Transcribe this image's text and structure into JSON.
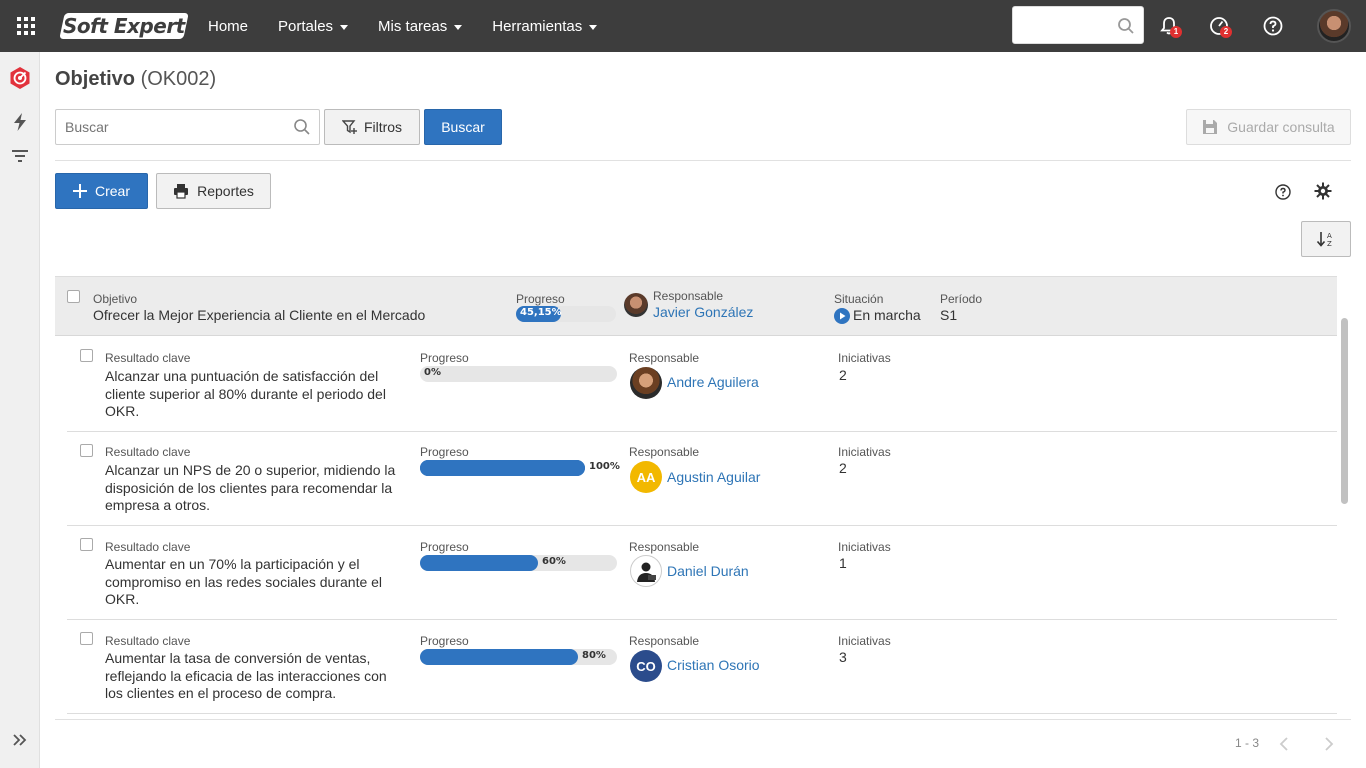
{
  "topbar": {
    "logo": "Soft Expert",
    "nav": [
      {
        "label": "Home",
        "has_caret": false
      },
      {
        "label": "Portales",
        "has_caret": true
      },
      {
        "label": "Mis tareas",
        "has_caret": true
      },
      {
        "label": "Herramientas",
        "has_caret": true
      }
    ],
    "notifications_badge": "1",
    "tasks_badge": "2"
  },
  "page": {
    "title": "Objetivo",
    "code": "(OK002)"
  },
  "toolbar": {
    "search_placeholder": "Buscar",
    "filters_label": "Filtros",
    "search_button": "Buscar",
    "save_query": "Guardar consulta",
    "create": "Crear",
    "reports": "Reportes"
  },
  "objective": {
    "col_objective": "Objetivo",
    "name": "Ofrecer la Mejor Experiencia al Cliente en el Mercado",
    "col_progress": "Progreso",
    "progress_text": "45,15%",
    "progress_value": 45.15,
    "col_owner": "Responsable",
    "owner": "Javier González",
    "col_status": "Situación",
    "status": "En marcha",
    "col_period": "Período",
    "period": "S1"
  },
  "key_results": [
    {
      "type": "Resultado clave",
      "text": "Alcanzar una puntuación de satisfacción del cliente superior al 80% durante el periodo del OKR.",
      "progress_label": "Progreso",
      "progress_text": "0%",
      "progress_value": 0,
      "owner_label": "Responsable",
      "owner": "Andre Aguilera",
      "initiatives_label": "Iniciativas",
      "initiatives": "2"
    },
    {
      "type": "Resultado clave",
      "text": "Alcanzar un NPS de 20 o superior, midiendo la disposición de los clientes para recomendar la empresa a otros.",
      "progress_label": "Progreso",
      "progress_text": "100%",
      "progress_value": 100,
      "owner_label": "Responsable",
      "owner": "Agustin Aguilar",
      "owner_initials": "AA",
      "initiatives_label": "Iniciativas",
      "initiatives": "2"
    },
    {
      "type": "Resultado clave",
      "text": "Aumentar en un 70% la participación y el compromiso en las redes sociales durante el OKR.",
      "progress_label": "Progreso",
      "progress_text": "60%",
      "progress_value": 60,
      "owner_label": "Responsable",
      "owner": "Daniel Durán",
      "initiatives_label": "Iniciativas",
      "initiatives": "1"
    },
    {
      "type": "Resultado clave",
      "text": "Aumentar la tasa de conversión de ventas, reflejando la eficacia de las interacciones con los clientes en el proceso de compra.",
      "progress_label": "Progreso",
      "progress_text": "80%",
      "progress_value": 80,
      "owner_label": "Responsable",
      "owner": "Cristian Osorio",
      "owner_initials": "CO",
      "initiatives_label": "Iniciativas",
      "initiatives": "3"
    }
  ],
  "pager": {
    "range": "1 - 3"
  },
  "colors": {
    "topbar": "#3d3d3d",
    "primary": "#2f74c0",
    "link": "#2e75b6",
    "badge": "#e03030",
    "avatar_aa": "#f2b800",
    "avatar_co": "#2b4c8c"
  }
}
